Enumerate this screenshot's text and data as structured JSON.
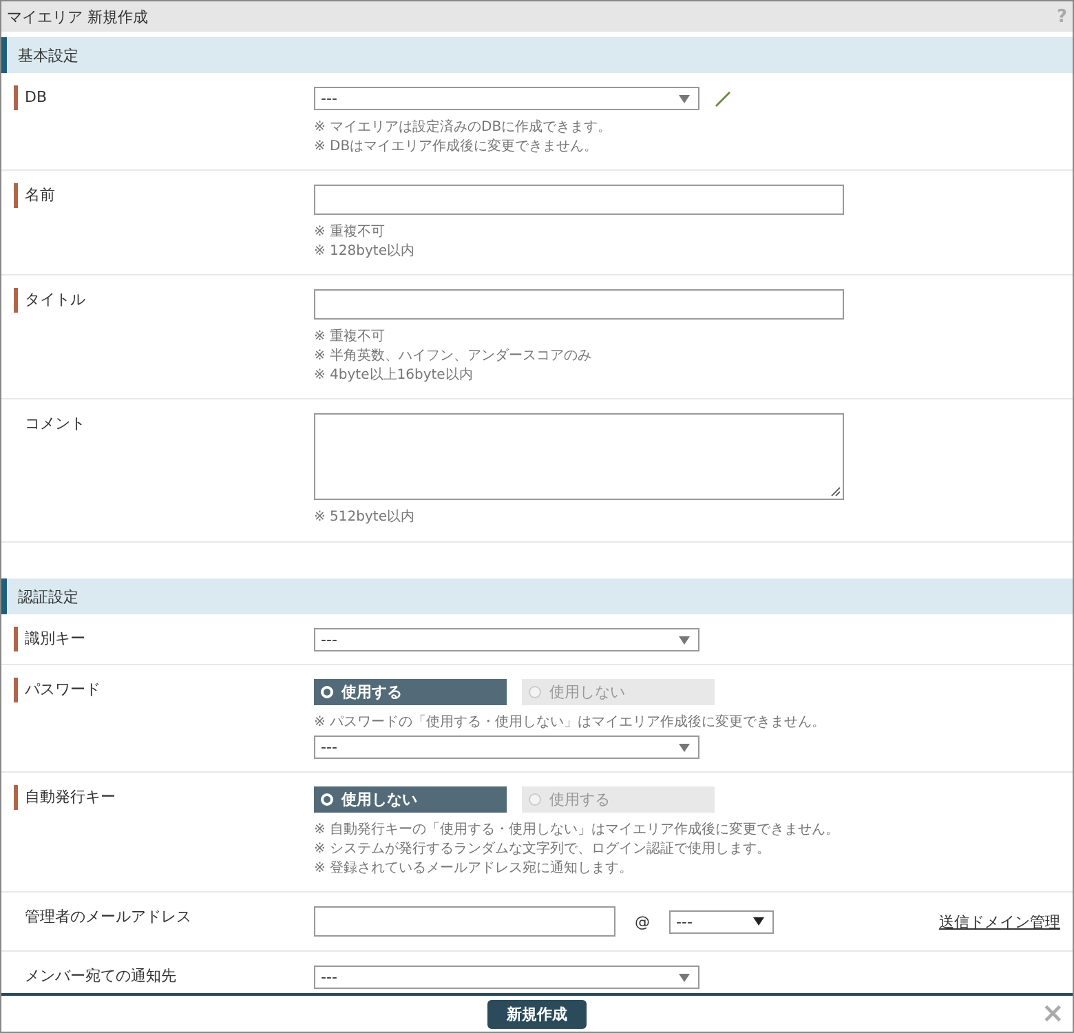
{
  "window": {
    "title": "マイエリア 新規作成",
    "help": "?"
  },
  "sections": [
    {
      "title": "基本設定",
      "rows": [
        {
          "label": "DB",
          "required": true,
          "kind": "select",
          "value": "---",
          "editable": true,
          "notes": [
            "※ マイエリアは設定済みのDBに作成できます。",
            "※ DBはマイエリア作成後に変更できません。"
          ]
        },
        {
          "label": "名前",
          "required": true,
          "kind": "text",
          "notes": [
            "※ 重複不可",
            "※ 128byte以内"
          ]
        },
        {
          "label": "タイトル",
          "required": true,
          "kind": "text",
          "notes": [
            "※ 重複不可",
            "※ 半角英数、ハイフン、アンダースコアのみ",
            "※ 4byte以上16byte以内"
          ]
        },
        {
          "label": "コメント",
          "required": false,
          "kind": "textarea",
          "notes": [
            "※ 512byte以内"
          ]
        }
      ]
    },
    {
      "title": "認証設定",
      "rows": [
        {
          "label": "識別キー",
          "required": true,
          "kind": "select",
          "value": "---"
        },
        {
          "label": "パスワード",
          "required": true,
          "kind": "radio",
          "options": [
            {
              "label": "使用する",
              "selected": true
            },
            {
              "label": "使用しない",
              "selected": false
            }
          ],
          "notes": [
            "※ パスワードの「使用する・使用しない」はマイエリア作成後に変更できません。"
          ],
          "extra_select": "---"
        },
        {
          "label": "自動発行キー",
          "required": true,
          "kind": "radio",
          "options": [
            {
              "label": "使用しない",
              "selected": true
            },
            {
              "label": "使用する",
              "selected": false
            }
          ],
          "notes": [
            "※ 自動発行キーの「使用する・使用しない」はマイエリア作成後に変更できません。",
            "※ システムが発行するランダムな文字列で、ログイン認証で使用します。",
            "※ 登録されているメールアドレス宛に通知します。"
          ]
        },
        {
          "label": "管理者のメールアドレス",
          "required": false,
          "kind": "email",
          "at": "@",
          "domain": "---",
          "link": "送信ドメイン管理"
        },
        {
          "label": "メンバー宛ての通知先",
          "required": false,
          "kind": "select",
          "value": "---"
        }
      ]
    }
  ],
  "footer": {
    "button": "新規作成",
    "close": "×"
  }
}
